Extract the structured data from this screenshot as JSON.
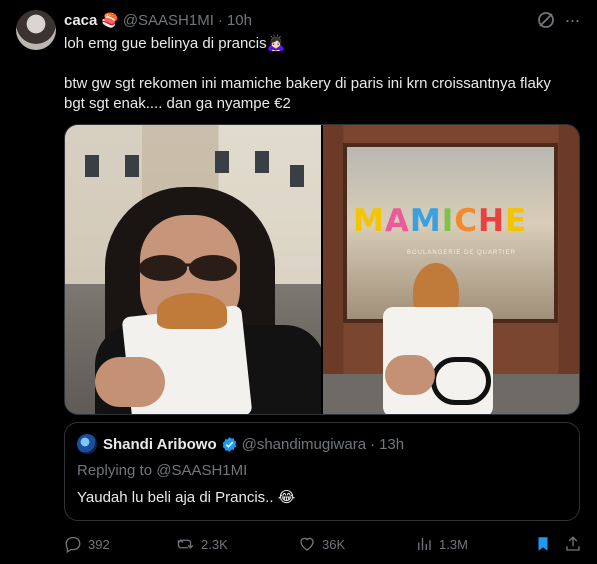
{
  "tweet": {
    "author_name": "caca",
    "author_emoji": "🍣",
    "handle": "@SAASH1MI",
    "separator": "·",
    "time": "10h",
    "more": "···",
    "line1": "loh emg gue belinya di prancis🙇🏻‍♀️",
    "line2": "btw gw sgt rekomen ini mamiche bakery di paris ini krn croissantnya flaky",
    "line3": "bgt sgt enak.... dan ga nyampe €2"
  },
  "media": {
    "sign_letters": [
      "M",
      "A",
      "M",
      "I",
      "C",
      "H",
      "E"
    ],
    "sign_subtitle": "BOULANGERIE DE QUARTIER"
  },
  "quote": {
    "name": "Shandi Aribowo",
    "handle": "@shandimugiwara",
    "separator": "·",
    "time": "13h",
    "replying_prefix": "Replying to ",
    "replying_mention": "@SAASH1MI",
    "text": "Yaudah lu beli aja di Prancis..",
    "emoji": "😂"
  },
  "actions": {
    "replies": "392",
    "reposts": "2.3K",
    "likes": "36K",
    "views": "1.3M"
  },
  "colors": {
    "background": "#000000",
    "text": "#e7e9ea",
    "muted": "#71767b",
    "border": "#2f3336",
    "verified": "#1d9bf0",
    "bookmark_active": "#1d9bf0"
  }
}
